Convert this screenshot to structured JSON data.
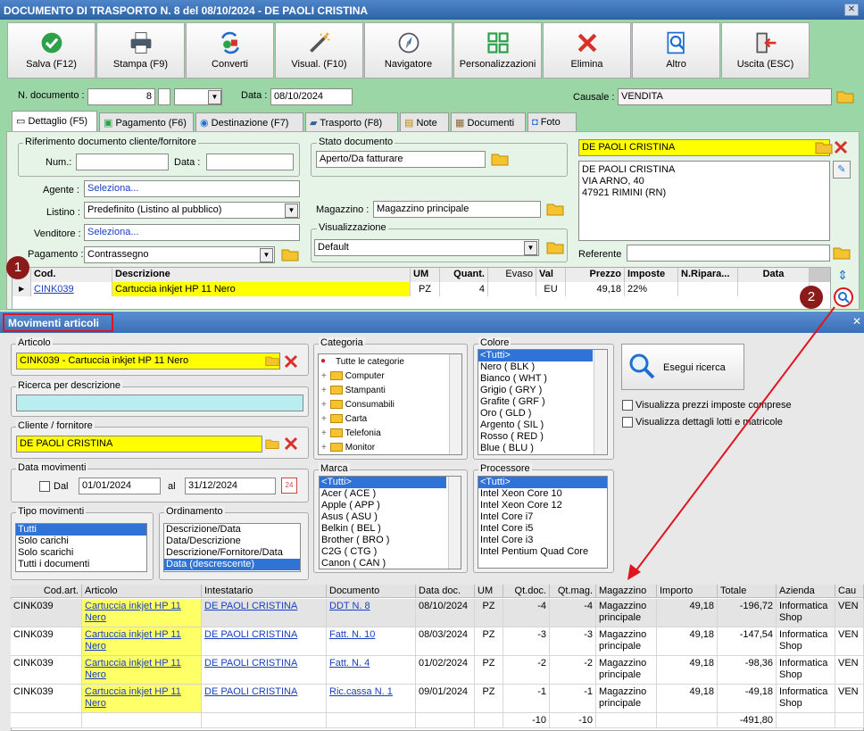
{
  "window": {
    "title": "DOCUMENTO DI TRASPORTO N. 8 del 08/10/2024 - DE PAOLI CRISTINA"
  },
  "toolbar": {
    "buttons": [
      "Salva (F12)",
      "Stampa (F9)",
      "Converti",
      "Visual. (F10)",
      "Navigatore",
      "Personalizzazioni",
      "Elimina",
      "Altro",
      "Uscita (ESC)"
    ]
  },
  "header": {
    "ndoc_label": "N. documento :",
    "ndoc_value": "8",
    "data_label": "Data :",
    "data_value": "08/10/2024",
    "causale_label": "Causale :",
    "causale_value": "VENDITA"
  },
  "tabs": [
    "Dettaglio (F5)",
    "Pagamento (F6)",
    "Destinazione (F7)",
    "Trasporto (F8)",
    "Note",
    "Documenti",
    "Foto"
  ],
  "dettaglio": {
    "rif_title": "Riferimento documento cliente/fornitore",
    "num_label": "Num.:",
    "data_label": "Data :",
    "agente_label": "Agente :",
    "agente_value": "Seleziona...",
    "listino_label": "Listino :",
    "listino_value": "Predefinito (Listino al pubblico)",
    "venditore_label": "Venditore :",
    "venditore_value": "Seleziona...",
    "pagamento_label": "Pagamento :",
    "pagamento_value": "Contrassegno",
    "stato_title": "Stato documento",
    "stato_value": "Aperto/Da fatturare",
    "magazzino_label": "Magazzino :",
    "magazzino_value": "Magazzino principale",
    "visual_title": "Visualizzazione",
    "visual_value": "Default",
    "cliente_name": "DE PAOLI CRISTINA",
    "cliente_address": [
      "DE PAOLI CRISTINA",
      "VIA ARNO, 40",
      "47921 RIMINI (RN)"
    ],
    "referente_label": "Referente"
  },
  "rows_grid": {
    "headers": [
      "Cod.",
      "Descrizione",
      "UM",
      "Quant.",
      "Evaso",
      "Val",
      "Prezzo",
      "Imposte",
      "N.Ripara...",
      "Data"
    ],
    "row": [
      "CINK039",
      "Cartuccia inkjet HP 11 Nero",
      "PZ",
      "4",
      "",
      "EU",
      "49,18",
      "22%",
      "",
      ""
    ]
  },
  "badges": [
    "1",
    "2"
  ],
  "movimenti": {
    "title": "Movimenti articoli",
    "articolo_title": "Articolo",
    "articolo_value": "CINK039 - Cartuccia inkjet HP 11 Nero",
    "ricerca_title": "Ricerca per descrizione",
    "cliente_title": "Cliente / fornitore",
    "cliente_value": "DE PAOLI CRISTINA",
    "datamov_title": "Data movimenti",
    "dal_label": "Dal",
    "dal_value": "01/01/2024",
    "al_label": "al",
    "al_value": "31/12/2024",
    "tipo_title": "Tipo movimenti",
    "tipo_items": [
      "Tutti",
      "Solo carichi",
      "Solo scarichi",
      "Tutti i documenti"
    ],
    "ord_title": "Ordinamento",
    "ord_items": [
      "Descrizione/Data",
      "Data/Descrizione",
      "Descrizione/Fornitore/Data",
      "Data (descrescente)"
    ],
    "categoria_title": "Categoria",
    "categoria_root": "Tutte le categorie",
    "categoria_items": [
      "Computer",
      "Stampanti",
      "Consumabili",
      "Carta",
      "Telefonia",
      "Monitor"
    ],
    "colore_title": "Colore",
    "colore_items": [
      "<Tutti>",
      "Nero ( BLK )",
      "Bianco ( WHT )",
      "Grigio ( GRY )",
      "Grafite ( GRF )",
      "Oro ( GLD )",
      "Argento ( SIL )",
      "Rosso ( RED )",
      "Blue ( BLU )"
    ],
    "marca_title": "Marca",
    "marca_items": [
      "<Tutti>",
      "Acer ( ACE )",
      "Apple ( APP )",
      "Asus ( ASU )",
      "Belkin ( BEL )",
      "Brother ( BRO )",
      "C2G ( CTG )",
      "Canon ( CAN )"
    ],
    "processore_title": "Processore",
    "processore_items": [
      "<Tutti>",
      "Intel Xeon Core 10",
      "Intel Xeon Core 12",
      "Intel Core i7",
      "Intel Core i5",
      "Intel Core i3",
      "Intel Pentium Quad Core"
    ],
    "esegui_label": "Esegui ricerca",
    "chk1_label": "Visualizza prezzi imposte comprese",
    "chk2_label": "Visualizza dettagli lotti e matricole",
    "result_headers": [
      "Cod.art.",
      "Articolo",
      "Intestatario",
      "Documento",
      "Data doc.",
      "UM",
      "Qt.doc.",
      "Qt.mag.",
      "Magazzino",
      "Importo",
      "Totale",
      "Azienda",
      "Cau"
    ],
    "result_rows": [
      [
        "CINK039",
        "Cartuccia inkjet HP 11 Nero",
        "DE PAOLI CRISTINA",
        "DDT N. 8",
        "08/10/2024",
        "PZ",
        "-4",
        "-4",
        "Magazzino principale",
        "49,18",
        "-196,72",
        "Informatica Shop",
        "VEN"
      ],
      [
        "CINK039",
        "Cartuccia inkjet HP 11 Nero",
        "DE PAOLI CRISTINA",
        "Fatt. N. 10",
        "08/03/2024",
        "PZ",
        "-3",
        "-3",
        "Magazzino principale",
        "49,18",
        "-147,54",
        "Informatica Shop",
        "VEN"
      ],
      [
        "CINK039",
        "Cartuccia inkjet HP 11 Nero",
        "DE PAOLI CRISTINA",
        "Fatt. N. 4",
        "01/02/2024",
        "PZ",
        "-2",
        "-2",
        "Magazzino principale",
        "49,18",
        "-98,36",
        "Informatica Shop",
        "VEN"
      ],
      [
        "CINK039",
        "Cartuccia inkjet HP 11 Nero",
        "DE PAOLI CRISTINA",
        "Ric.cassa N. 1",
        "09/01/2024",
        "PZ",
        "-1",
        "-1",
        "Magazzino principale",
        "49,18",
        "-49,18",
        "Informatica Shop",
        "VEN"
      ]
    ],
    "totals": {
      "qtdoc": "-10",
      "qtmag": "-10",
      "totale": "-491,80"
    }
  },
  "colors": {
    "accent": "#2f73d6",
    "highlight": "#ffff00",
    "form_bg": "#9bd6a6",
    "annotation": "#e0141e"
  }
}
